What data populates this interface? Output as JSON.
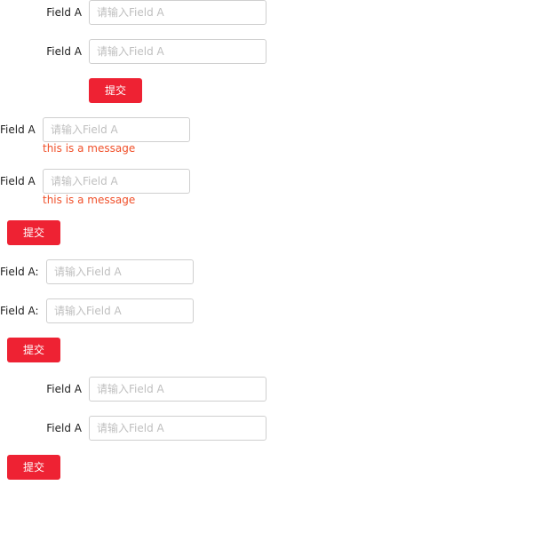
{
  "form1": {
    "fields": [
      {
        "label": "Field A",
        "placeholder": "请输入Field A"
      },
      {
        "label": "Field A",
        "placeholder": "请输入Field A"
      }
    ],
    "submit_label": "提交"
  },
  "form2": {
    "fields": [
      {
        "label": "Field A",
        "placeholder": "请输入Field A",
        "message": "this is a message"
      },
      {
        "label": "Field A",
        "placeholder": "请输入Field A",
        "message": "this is a message"
      }
    ],
    "submit_label": "提交"
  },
  "form3": {
    "fields": [
      {
        "label": "Field A:",
        "placeholder": "请输入Field A"
      },
      {
        "label": "Field A:",
        "placeholder": "请输入Field A"
      }
    ],
    "submit_label": "提交"
  },
  "form4": {
    "fields": [
      {
        "label": "Field A",
        "placeholder": "请输入Field A"
      },
      {
        "label": "Field A",
        "placeholder": "请输入Field A"
      }
    ],
    "submit_label": "提交"
  },
  "colors": {
    "primary_button": "#ee2233",
    "error_message": "#f0502a",
    "input_border": "#cfcfcf",
    "placeholder": "#bfbfbf"
  }
}
